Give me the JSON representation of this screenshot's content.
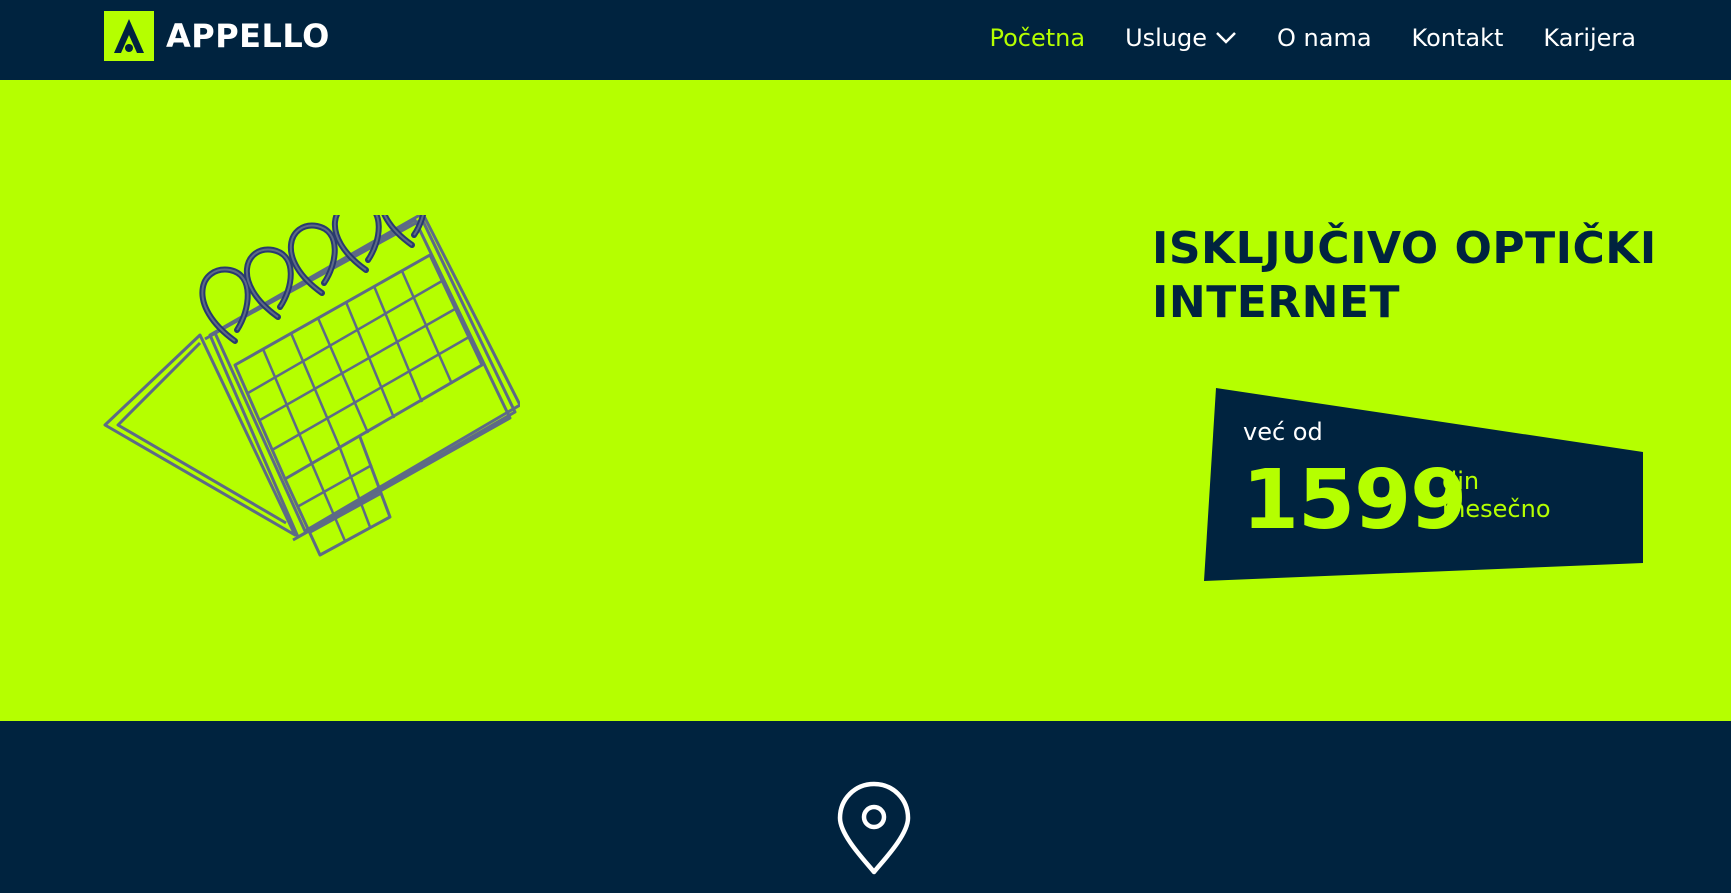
{
  "brand": {
    "name": "APPELLO",
    "accent": "#b5ff00",
    "dark": "#00233f"
  },
  "nav": {
    "items": [
      {
        "label": "Početna",
        "active": true
      },
      {
        "label": "Usluge",
        "has_dropdown": true
      },
      {
        "label": "O nama"
      },
      {
        "label": "Kontakt"
      },
      {
        "label": "Karijera"
      }
    ]
  },
  "hero": {
    "headline_line1": "ISKLJUČIVO OPTIČKI",
    "headline_line2": "INTERNET",
    "price_from": "već od",
    "price_value": "1599",
    "price_currency": "din",
    "price_period": "mesečno",
    "illustration": "calendar-icon"
  },
  "location": {
    "icon": "map-pin-icon"
  }
}
